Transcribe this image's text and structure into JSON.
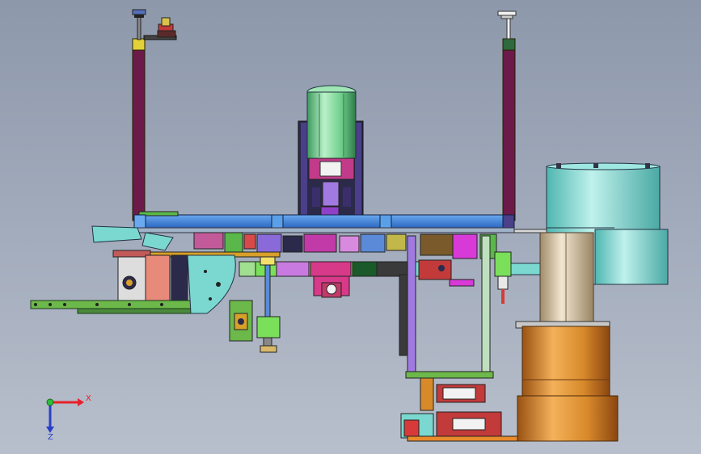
{
  "viewport": {
    "background_top": "#8d98ab",
    "background_bottom": "#b8bfcc"
  },
  "triad": {
    "x_label": "X",
    "y_label": "Y",
    "z_label": "Z",
    "x_color": "#e8202a",
    "y_color": "#2bbf3a",
    "z_color": "#2a3fc8"
  },
  "palette": {
    "frame_purple": "#6b1a4a",
    "beam_blue": "#3d7fd8",
    "motor_green": "#7fd89a",
    "tank_cyan": "#7fd6d0",
    "tank_bronze": "#d8892a",
    "rail_green": "#6cb84a"
  }
}
